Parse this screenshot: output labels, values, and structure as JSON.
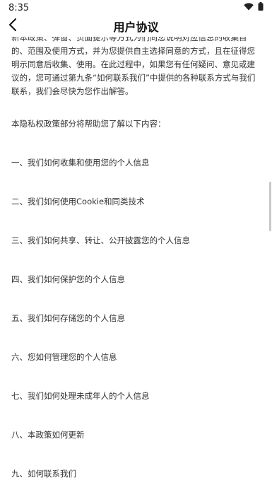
{
  "status_bar": {
    "time": "8:35",
    "icons": [
      "wifi-icon",
      "battery-icon"
    ]
  },
  "nav": {
    "title": "用户协议",
    "back_icon": "chevron-left-icon"
  },
  "content": {
    "intro": "新本政策、弹窗、页面提示等方式为们同您说明对应信息的收集目的、范围及使用方式，并为您提供自主选择同意的方式，且在征得您明示同意后收集、使用。在此过程中，如果您有任何疑问、意见或建议的，您可通过第九条“如何联系我们”中提供的各种联系方式与我们联系，我们会尽快为您作出解答。",
    "lead": "本隐私权政策部分将帮助您了解以下内容：",
    "toc": [
      "一、我们如何收集和使用您的个人信息",
      "二、我们如何使用Cookie和同类技术",
      "三、我们如何共享、转让、公开披露您的个人信息",
      "四、我们如何保护您的个人信息",
      "五、我们如何存储您的个人信息",
      "六、您如何管理您的个人信息",
      "七、我们如何处理未成年人的个人信息",
      "八、本政策如何更新",
      "九、如何联系我们"
    ]
  }
}
